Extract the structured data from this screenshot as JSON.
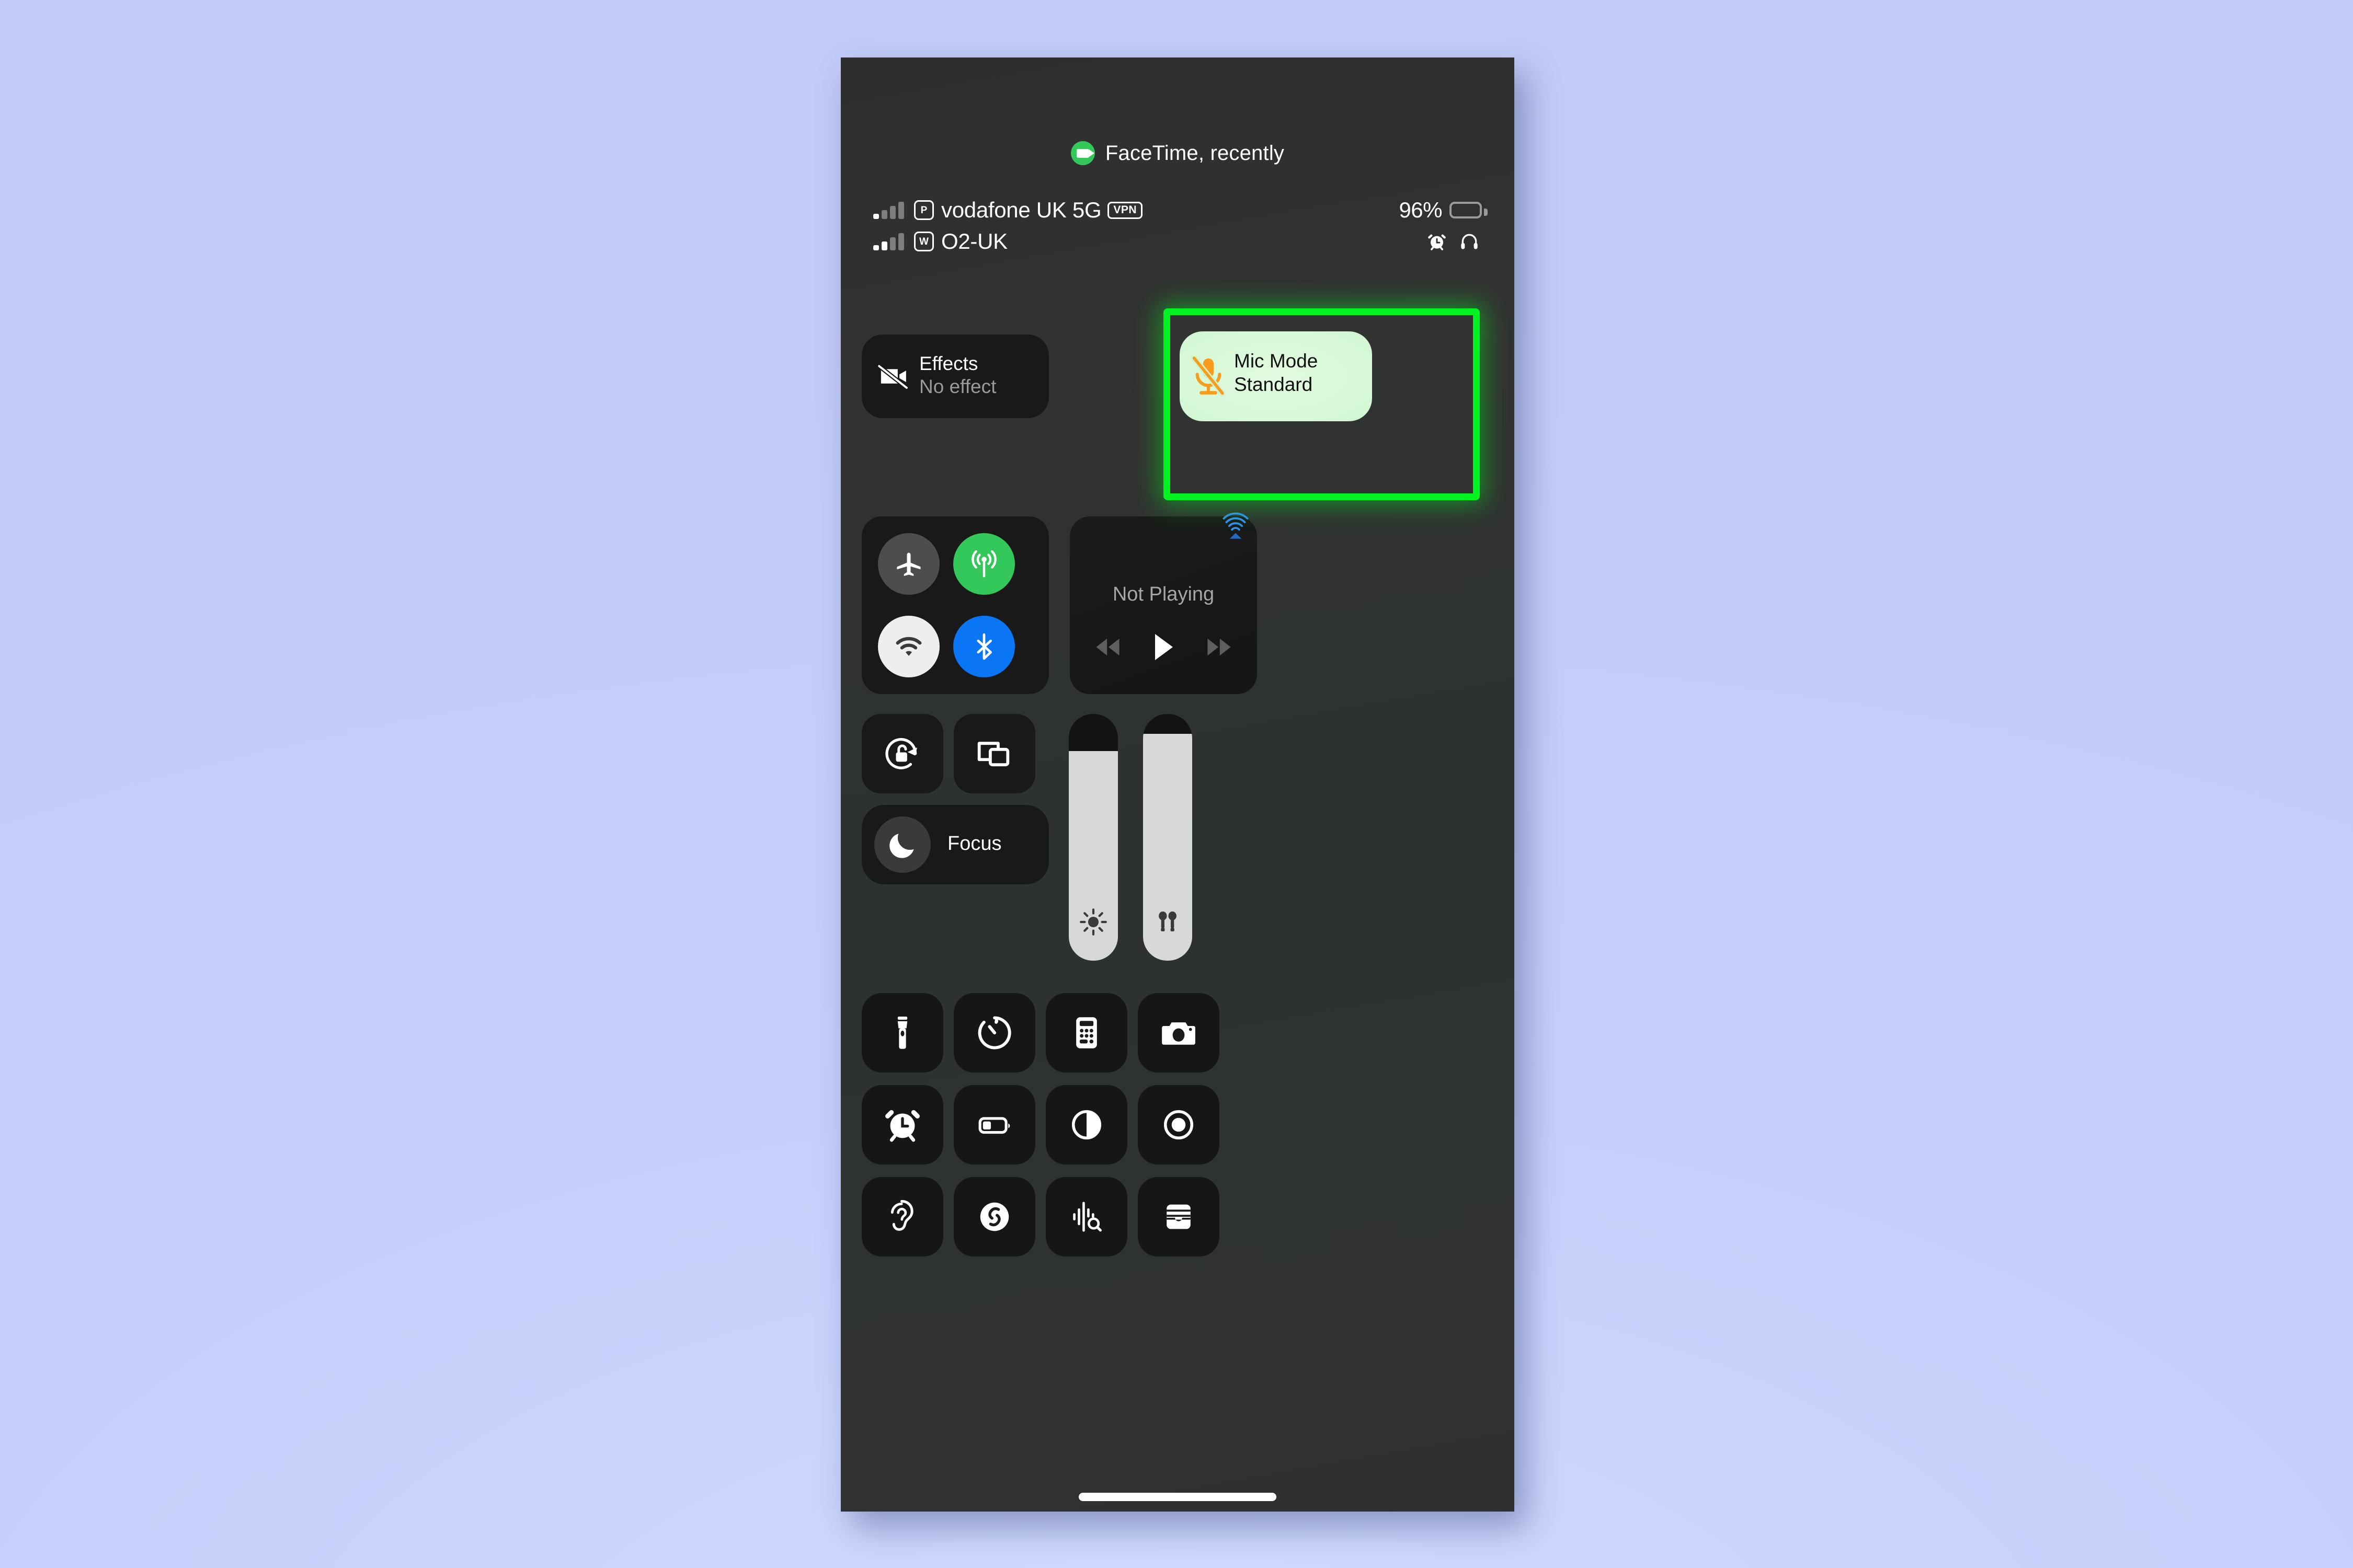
{
  "wallpaper": {
    "color": "#c3cdf8"
  },
  "phone": {
    "screen_bg": "#303030"
  },
  "dynamic_island": {
    "app_label": "FaceTime, recently",
    "icon": "facetime-video-icon",
    "badge_color": "#34c759"
  },
  "status_bar": {
    "line1": {
      "signal_bars_filled": 1,
      "signal_bars_total": 4,
      "carrier_badge": "P",
      "carrier": "vodafone UK 5G",
      "vpn_badge": "VPN"
    },
    "line2": {
      "signal_bars_filled": 2,
      "signal_bars_total": 4,
      "carrier_badge": "W",
      "carrier": "O2-UK"
    },
    "battery_percent": "96%",
    "battery_level": 96,
    "right_icons": [
      "alarm-clock-icon",
      "headphones-icon"
    ]
  },
  "highlight": {
    "color": "#00f321",
    "target": "mic-mode-tile"
  },
  "call_controls": [
    {
      "id": "effects",
      "title": "Effects",
      "subtitle": "No effect",
      "icon": "video-camera-slash-icon",
      "active": false
    },
    {
      "id": "mic-mode",
      "title": "Mic Mode",
      "subtitle": "Standard",
      "icon": "microphone-slash-icon",
      "icon_color": "#f99c1c",
      "active": true,
      "bg_color": "#ccf5cd"
    }
  ],
  "connectivity": [
    {
      "id": "airplane-mode",
      "icon": "airplane-icon",
      "state": "off",
      "color": "#4d4d4d"
    },
    {
      "id": "cellular-data",
      "icon": "cellular-icon",
      "state": "on",
      "color": "#34c759"
    },
    {
      "id": "wifi",
      "icon": "wifi-icon",
      "state": "on",
      "color": "#eeeeee"
    },
    {
      "id": "bluetooth",
      "icon": "bluetooth-icon",
      "state": "on",
      "color": "#0a76f6"
    }
  ],
  "media": {
    "status": "Not Playing",
    "airplay_icon": "airplay-audio-icon",
    "airplay_color": "#1e7ae8",
    "controls": [
      "rewind-icon",
      "play-icon",
      "fast-forward-icon"
    ]
  },
  "quick_toggles": [
    {
      "id": "rotation-lock",
      "icon": "rotation-lock-icon"
    },
    {
      "id": "screen-mirroring",
      "icon": "screen-mirroring-icon"
    }
  ],
  "focus": {
    "label": "Focus",
    "icon": "moon-icon"
  },
  "sliders": [
    {
      "id": "brightness",
      "icon": "brightness-sun-icon",
      "value": 85
    },
    {
      "id": "volume",
      "icon": "airpods-icon",
      "value": 92
    }
  ],
  "icon_grid": [
    {
      "id": "flashlight",
      "icon": "flashlight-icon"
    },
    {
      "id": "timer",
      "icon": "timer-icon"
    },
    {
      "id": "calculator",
      "icon": "calculator-icon"
    },
    {
      "id": "camera",
      "icon": "camera-icon"
    },
    {
      "id": "alarm",
      "icon": "alarm-clock-icon"
    },
    {
      "id": "low-power-mode",
      "icon": "battery-low-power-icon"
    },
    {
      "id": "dark-mode",
      "icon": "dark-mode-icon"
    },
    {
      "id": "screen-recording",
      "icon": "screen-record-icon"
    },
    {
      "id": "hearing",
      "icon": "ear-hearing-icon"
    },
    {
      "id": "shazam",
      "icon": "shazam-icon"
    },
    {
      "id": "sound-recognition",
      "icon": "sound-recognition-icon"
    },
    {
      "id": "wallet",
      "icon": "wallet-icon"
    }
  ],
  "home_indicator": {
    "visible": true
  }
}
